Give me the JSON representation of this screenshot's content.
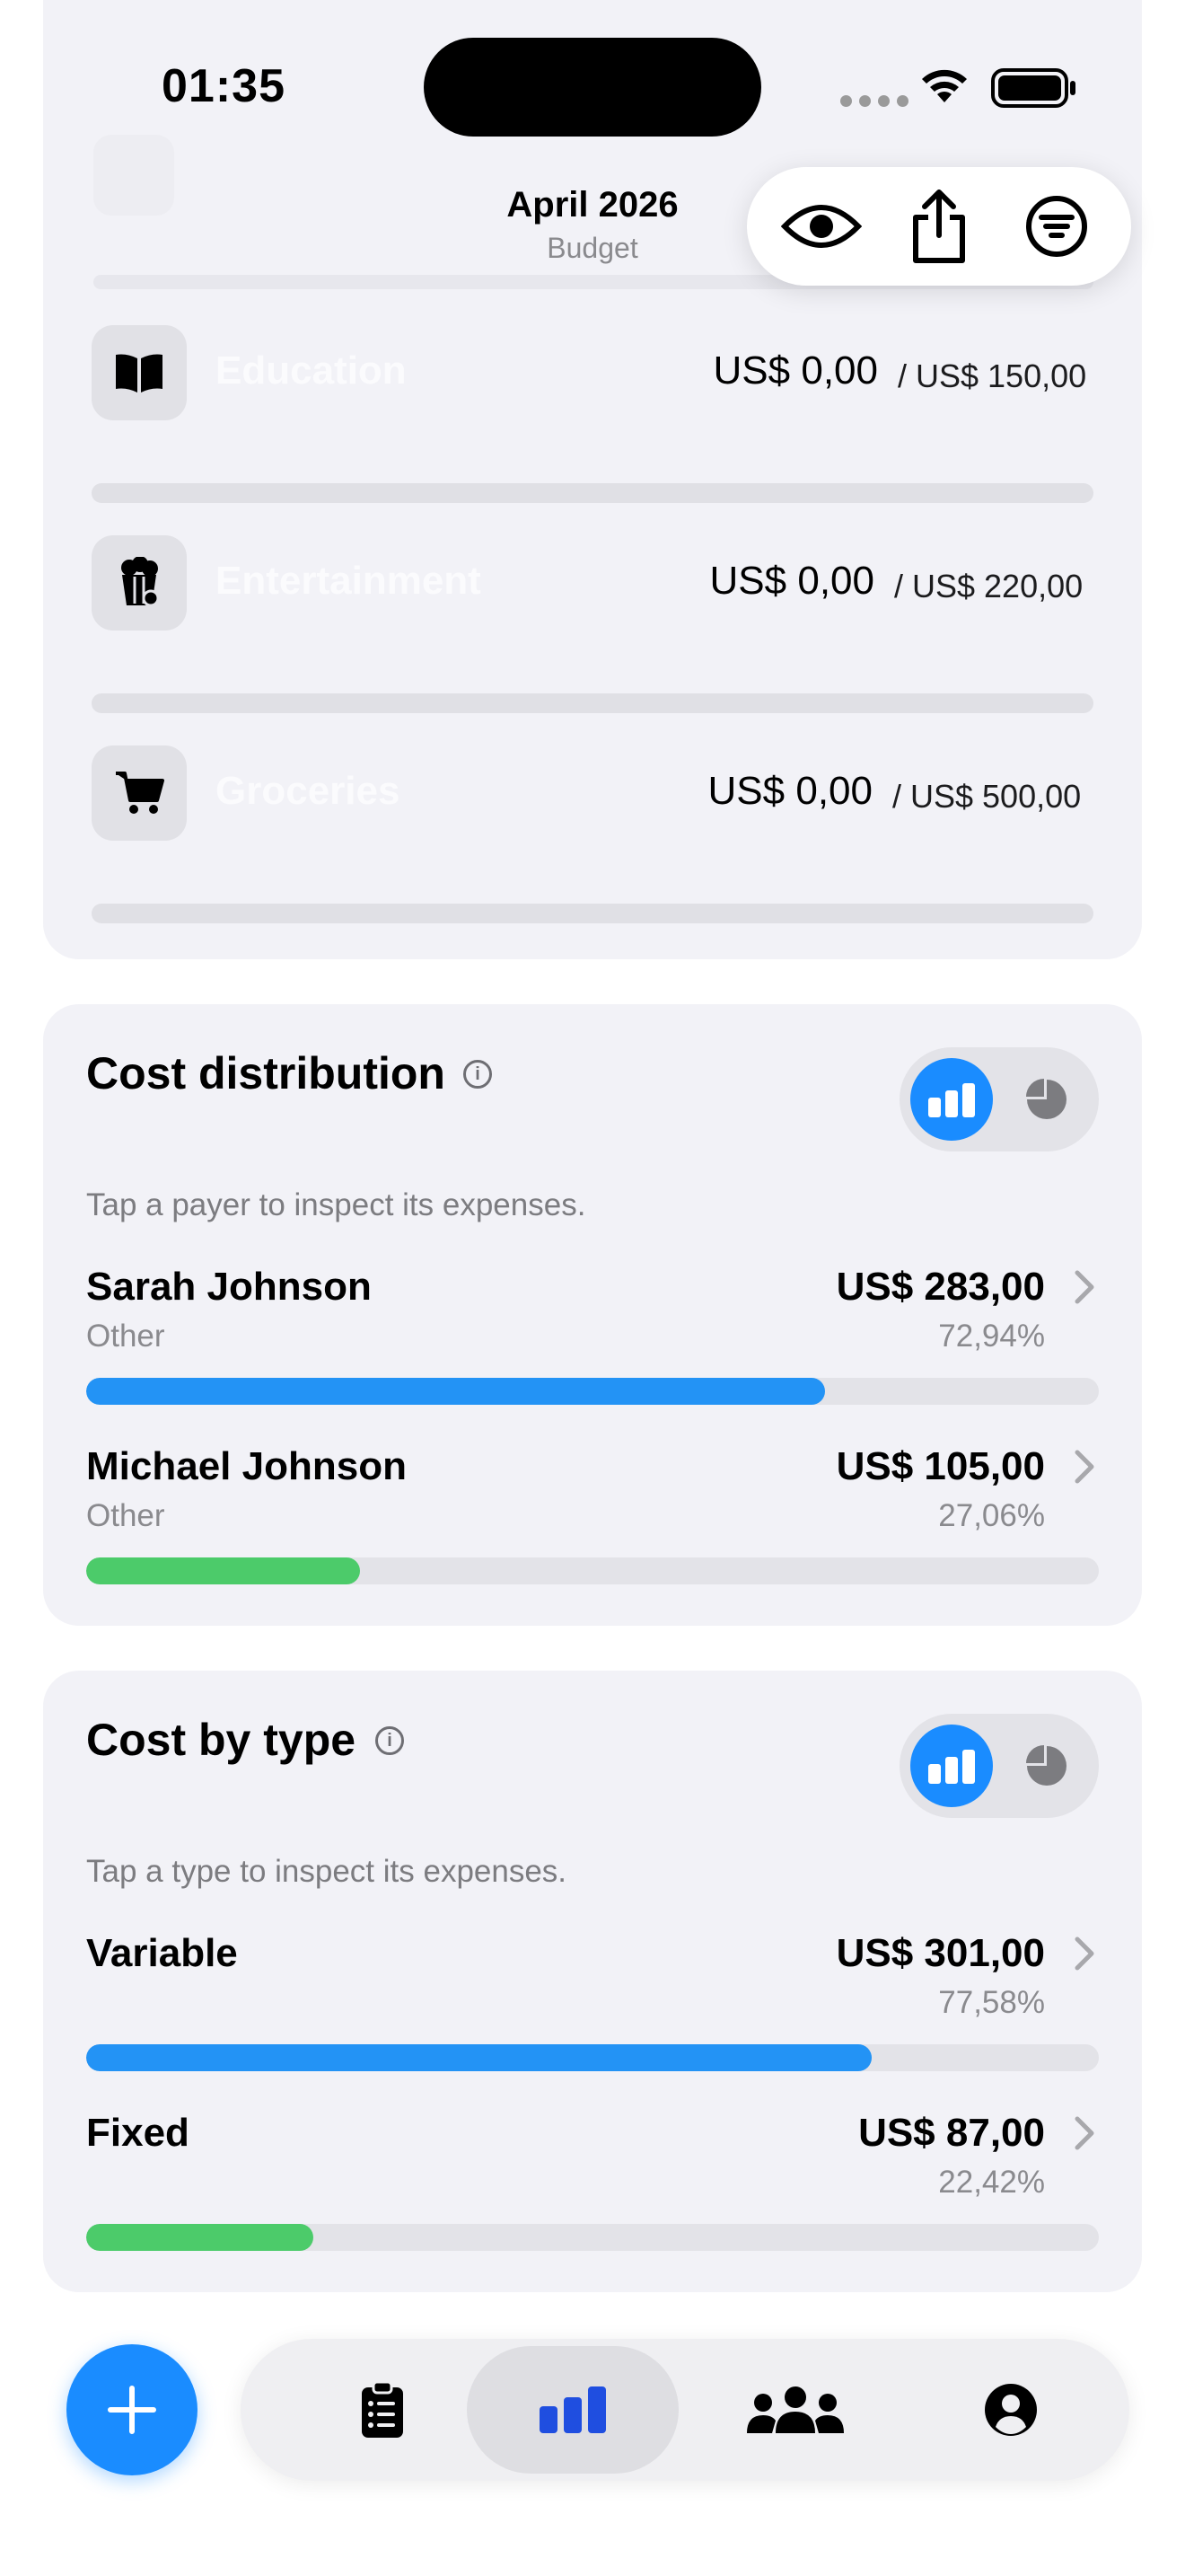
{
  "status": {
    "time": "01:35"
  },
  "header": {
    "title": "April 2026",
    "subtitle": "Budget"
  },
  "toolbar": {
    "icons": [
      "eye-icon",
      "share-icon",
      "filter-icon"
    ]
  },
  "categories": [
    {
      "name": "Education",
      "icon": "book-icon",
      "amount": "US$ 0,00",
      "total": "/ US$ 150,00",
      "progress": 0
    },
    {
      "name": "Entertainment",
      "icon": "popcorn-icon",
      "amount": "US$ 0,00",
      "total": "/ US$ 220,00",
      "progress": 0
    },
    {
      "name": "Groceries",
      "icon": "cart-icon",
      "amount": "US$ 0,00",
      "total": "/ US$ 500,00",
      "progress": 0
    }
  ],
  "cost_distribution": {
    "title": "Cost distribution",
    "hint": "Tap a payer to inspect its expenses.",
    "rows": [
      {
        "name": "Sarah Johnson",
        "sub": "Other",
        "amount": "US$ 283,00",
        "percent": "72,94%",
        "fraction": 0.7294,
        "color": "#2393f5"
      },
      {
        "name": "Michael Johnson",
        "sub": "Other",
        "amount": "US$ 105,00",
        "percent": "27,06%",
        "fraction": 0.2706,
        "color": "#4ccb6a"
      }
    ]
  },
  "cost_by_type": {
    "title": "Cost by type",
    "hint": "Tap a type to inspect its expenses.",
    "rows": [
      {
        "name": "Variable",
        "amount": "US$ 301,00",
        "percent": "77,58%",
        "fraction": 0.7758,
        "color": "#2393f5"
      },
      {
        "name": "Fixed",
        "amount": "US$ 87,00",
        "percent": "22,42%",
        "fraction": 0.2242,
        "color": "#4ccb6a"
      }
    ]
  },
  "tabbar": {
    "tabs": [
      {
        "icon": "clipboard-list-icon",
        "active": false
      },
      {
        "icon": "bar-chart-icon",
        "active": true
      },
      {
        "icon": "people-icon",
        "active": false
      },
      {
        "icon": "person-circle-icon",
        "active": false
      }
    ]
  },
  "colors": {
    "accent": "#1a8cff",
    "green": "#4ccb6a",
    "blue_bar": "#2393f5"
  }
}
